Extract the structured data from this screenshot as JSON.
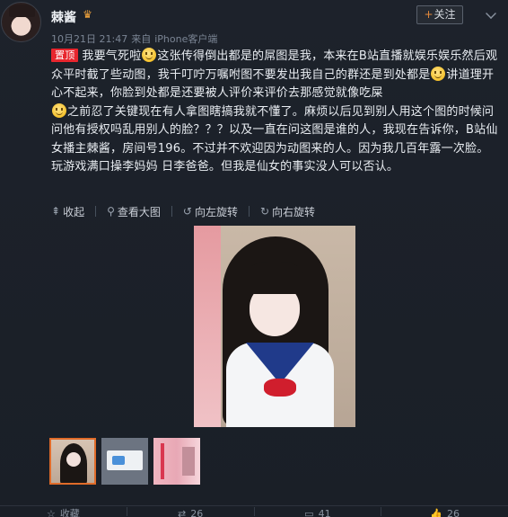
{
  "user": {
    "name": "棘酱",
    "vip_badge_icon": "crown-icon",
    "time": "10月21日 21:47",
    "source_prefix": "来自",
    "source": "iPhone客户端"
  },
  "follow_button": {
    "plus": "+",
    "label": "关注"
  },
  "post": {
    "pin_badge": "置顶",
    "segments": [
      "我要气死啦",
      "这张传得倒出都是的屌图是我，本来在B站直播就娱乐娱乐然后观众平时截了些动图，我千叮咛万嘱咐图不要发出我自己的群还是到处都是",
      "讲道理开心不起来，你脸到处都是还要被人评价来评价去那感觉就像吃屎",
      "之前忍了关键现在有人拿图瞎搞我就不懂了。麻烦以后见到别人用这个图的时候问问他有授权吗乱用别人的脸？？？以及一直在问这图是谁的人，我现在告诉你，B站仙女播主棘酱，房间号196。不过并不欢迎因为动图来的人。因为我几百年露一次脸。玩游戏满口操李妈妈 日李爸爸。但我是仙女的事实没人可以否认。"
    ],
    "emoji_icon": "smile-emoji-icon"
  },
  "toolbar": [
    {
      "icon": "collapse-icon",
      "glyph": "⇞",
      "label": "收起"
    },
    {
      "icon": "zoom-icon",
      "glyph": "⚲",
      "label": "查看大图"
    },
    {
      "icon": "rotate-left-icon",
      "glyph": "↺",
      "label": "向左旋转"
    },
    {
      "icon": "rotate-right-icon",
      "glyph": "↻",
      "label": "向右旋转"
    }
  ],
  "footer": [
    {
      "icon": "collect-icon",
      "glyph": "☆",
      "label": "收藏"
    },
    {
      "icon": "repost-icon",
      "glyph": "⇄",
      "label": "26"
    },
    {
      "icon": "comment-icon",
      "glyph": "▭",
      "label": "41"
    },
    {
      "icon": "like-icon",
      "glyph": "👍",
      "label": "26"
    }
  ],
  "colors": {
    "accent": "#e06b29",
    "pin_red": "#e8262e",
    "background": "#1b2028"
  }
}
